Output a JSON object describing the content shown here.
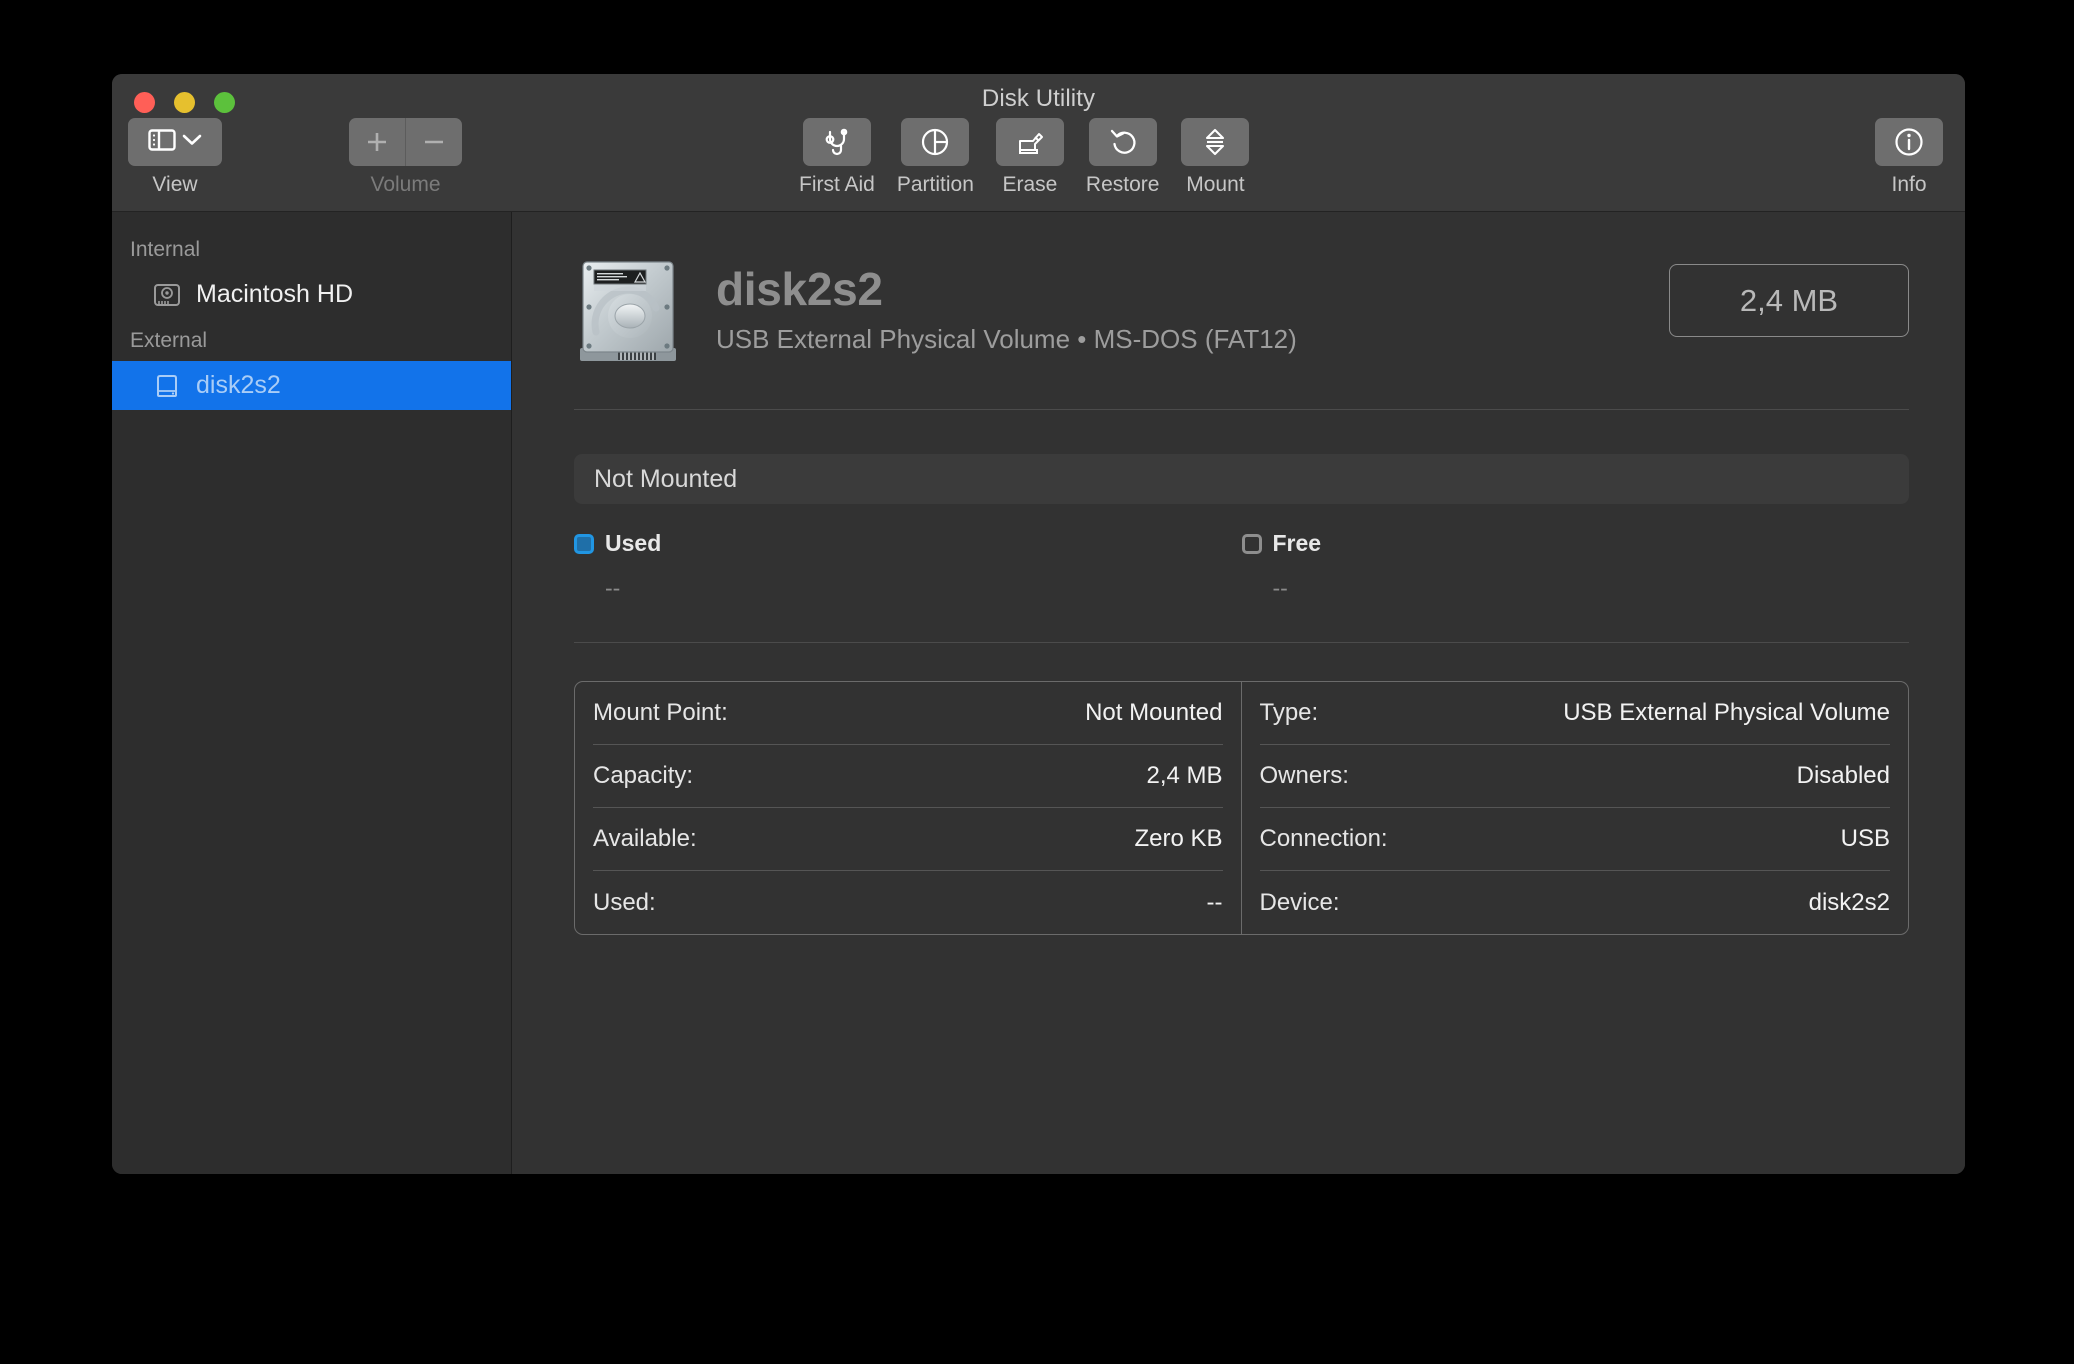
{
  "window": {
    "title": "Disk Utility",
    "traffic_lights": [
      "close-button",
      "minimize-button",
      "zoom-button"
    ]
  },
  "toolbar": {
    "view": {
      "label": "View",
      "icon": "sidebar-icon",
      "chevron": "chevron-down-icon"
    },
    "volume": {
      "label": "Volume",
      "add": "+",
      "remove": "−",
      "enabled": false
    },
    "actions": [
      {
        "label": "First Aid",
        "icon": "stethoscope-icon"
      },
      {
        "label": "Partition",
        "icon": "pie-chart-icon"
      },
      {
        "label": "Erase",
        "icon": "eraser-icon"
      },
      {
        "label": "Restore",
        "icon": "undo-arrow-icon"
      },
      {
        "label": "Mount",
        "icon": "eject-icon"
      }
    ],
    "info": {
      "label": "Info",
      "icon": "info-circle-icon"
    }
  },
  "sidebar": {
    "groups": [
      {
        "header": "Internal",
        "items": [
          {
            "label": "Macintosh HD",
            "icon": "internal-drive-icon",
            "selected": false
          }
        ]
      },
      {
        "header": "External",
        "items": [
          {
            "label": "disk2s2",
            "icon": "external-drive-icon",
            "selected": true
          }
        ]
      }
    ]
  },
  "main": {
    "volume_icon": "hard-drive-icon",
    "volume_name": "disk2s2",
    "volume_subtitle": "USB External Physical Volume • MS-DOS (FAT12)",
    "capacity_badge": "2,4 MB",
    "usage_bar_label": "Not Mounted",
    "legend": [
      {
        "name": "Used",
        "value": "--",
        "color": "#2196e3"
      },
      {
        "name": "Free",
        "value": "--",
        "color": "#8e8e8e"
      }
    ],
    "details_left": [
      {
        "label": "Mount Point:",
        "value": "Not Mounted"
      },
      {
        "label": "Capacity:",
        "value": "2,4 MB"
      },
      {
        "label": "Available:",
        "value": "Zero KB"
      },
      {
        "label": "Used:",
        "value": "--"
      }
    ],
    "details_right": [
      {
        "label": "Type:",
        "value": "USB External Physical Volume"
      },
      {
        "label": "Owners:",
        "value": "Disabled"
      },
      {
        "label": "Connection:",
        "value": "USB"
      },
      {
        "label": "Device:",
        "value": "disk2s2"
      }
    ]
  },
  "colors": {
    "selection_blue": "#1273ea",
    "used_blue": "#2196e3",
    "window_bg": "#323232",
    "sidebar_bg": "#2d2d2d",
    "toolbar_bg": "#3a3a3a"
  }
}
